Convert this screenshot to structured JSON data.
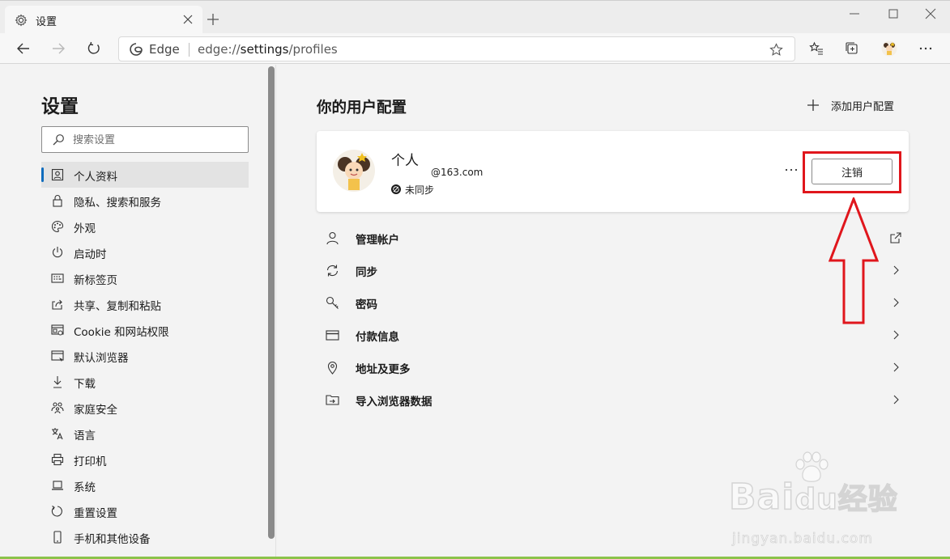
{
  "window": {
    "tab_title": "设置",
    "tab_icon": "gear-icon",
    "colors": {
      "accent": "#0f6cbd",
      "highlight": "#e0161c",
      "background": "#f3f3f3",
      "card": "#ffffff"
    }
  },
  "address_bar": {
    "edge_label": "Edge",
    "url_prefix": "edge://",
    "url_path": "settings",
    "url_suffix": "/profiles"
  },
  "sidebar": {
    "heading": "设置",
    "search_placeholder": "搜索设置",
    "items": [
      {
        "label": "个人资料",
        "icon": "profile-icon",
        "active": true
      },
      {
        "label": "隐私、搜索和服务",
        "icon": "lock-icon"
      },
      {
        "label": "外观",
        "icon": "palette-icon"
      },
      {
        "label": "启动时",
        "icon": "power-icon"
      },
      {
        "label": "新标签页",
        "icon": "grid-icon"
      },
      {
        "label": "共享、复制和粘贴",
        "icon": "share-icon"
      },
      {
        "label": "Cookie 和网站权限",
        "icon": "site-permissions-icon"
      },
      {
        "label": "默认浏览器",
        "icon": "browser-icon"
      },
      {
        "label": "下载",
        "icon": "download-icon"
      },
      {
        "label": "家庭安全",
        "icon": "family-icon"
      },
      {
        "label": "语言",
        "icon": "language-icon"
      },
      {
        "label": "打印机",
        "icon": "printer-icon"
      },
      {
        "label": "系统",
        "icon": "laptop-icon"
      },
      {
        "label": "重置设置",
        "icon": "reset-icon"
      },
      {
        "label": "手机和其他设备",
        "icon": "phone-icon"
      }
    ]
  },
  "main": {
    "title": "你的用户配置",
    "add_profile_label": "添加用户配置",
    "profile": {
      "name": "个人",
      "email": "@163.com",
      "sync_status": "未同步",
      "signout_label": "注销"
    },
    "rows": [
      {
        "label": "管理帐户",
        "icon": "person-icon",
        "action": "external-link-icon"
      },
      {
        "label": "同步",
        "icon": "sync-icon",
        "action": "chevron-right-icon"
      },
      {
        "label": "密码",
        "icon": "key-icon",
        "action": "chevron-right-icon"
      },
      {
        "label": "付款信息",
        "icon": "card-icon",
        "action": "chevron-right-icon"
      },
      {
        "label": "地址及更多",
        "icon": "location-icon",
        "action": "chevron-right-icon"
      },
      {
        "label": "导入浏览器数据",
        "icon": "import-icon",
        "action": "chevron-right-icon"
      }
    ]
  },
  "watermark": {
    "main_text": "Bai",
    "main_text_2": "du经验",
    "sub_text": "jingyan.baidu.com"
  }
}
